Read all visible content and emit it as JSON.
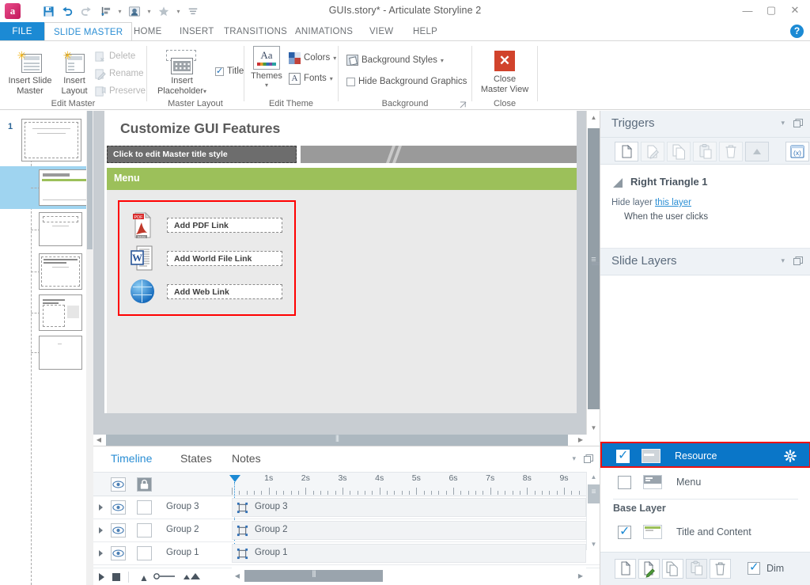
{
  "window": {
    "title": "GUIs.story* -  Articulate Storyline 2",
    "logo_letter": "a",
    "minimize": "—",
    "maximize": "▢",
    "close": "✕",
    "help": "?"
  },
  "quick_access": [
    {
      "name": "save-icon",
      "glyph": "save"
    },
    {
      "name": "undo-icon",
      "glyph": "undo"
    },
    {
      "name": "redo-icon",
      "glyph": "redo"
    },
    {
      "name": "align-icon",
      "glyph": "align"
    },
    {
      "name": "player-icon",
      "glyph": "player"
    },
    {
      "name": "star-icon",
      "glyph": "star"
    },
    {
      "name": "customize-icon",
      "glyph": "bars"
    }
  ],
  "tabs": [
    {
      "label": "FILE",
      "state": "file"
    },
    {
      "label": "SLIDE MASTER",
      "state": "active"
    },
    {
      "label": "HOME",
      "state": "normal"
    },
    {
      "label": "INSERT",
      "state": "normal"
    },
    {
      "label": "TRANSITIONS",
      "state": "normal"
    },
    {
      "label": "ANIMATIONS",
      "state": "normal"
    },
    {
      "label": "VIEW",
      "state": "normal"
    },
    {
      "label": "HELP",
      "state": "normal"
    }
  ],
  "ribbon": {
    "groups": [
      {
        "label": "Edit Master"
      },
      {
        "label": "Master Layout"
      },
      {
        "label": "Edit Theme"
      },
      {
        "label": "Background"
      },
      {
        "label": "Close"
      }
    ],
    "insert_slide_master": {
      "line1": "Insert Slide",
      "line2": "Master"
    },
    "insert_layout": {
      "line1": "Insert",
      "line2": "Layout"
    },
    "delete": "Delete",
    "rename": "Rename",
    "preserve": "Preserve",
    "insert_placeholder": "Insert\nPlaceholder",
    "insert_placeholder_l1": "Insert",
    "insert_placeholder_l2": "Placeholder",
    "title_checkbox": "Title",
    "themes": "Themes",
    "colors": "Colors",
    "fonts": "Fonts",
    "background_styles": "Background Styles",
    "hide_background_graphics": "Hide Background Graphics",
    "close_master_view_l1": "Close",
    "close_master_view_l2": "Master View",
    "dialog_launcher": "⌐"
  },
  "thumbnails": {
    "number": "1",
    "items": [
      {
        "type": "master",
        "selected": false
      },
      {
        "type": "title-content",
        "selected": true
      },
      {
        "type": "title-only",
        "selected": false
      },
      {
        "type": "content-a",
        "selected": false
      },
      {
        "type": "content-b",
        "selected": false
      },
      {
        "type": "blank",
        "selected": false
      }
    ]
  },
  "slide": {
    "title": "Customize GUI Features",
    "master_title_placeholder": "Click to edit Master title style",
    "menu_bar_label": "Menu",
    "links": [
      {
        "icon": "pdf-icon",
        "label": "Add PDF Link"
      },
      {
        "icon": "word-icon",
        "label": "Add World File Link"
      },
      {
        "icon": "web-icon",
        "label": "Add Web Link"
      }
    ]
  },
  "bottom_panel": {
    "tabs": [
      {
        "label": "Timeline",
        "active": true
      },
      {
        "label": "States",
        "active": false
      },
      {
        "label": "Notes",
        "active": false
      }
    ],
    "ruler_labels": [
      "1s",
      "2s",
      "3s",
      "4s",
      "5s",
      "6s",
      "7s",
      "8s",
      "9s"
    ],
    "rows": [
      {
        "name": "Group 3",
        "bar_label": "Group  3"
      },
      {
        "name": "Group 2",
        "bar_label": "Group  2"
      },
      {
        "name": "Group 1",
        "bar_label": "Group  1"
      }
    ],
    "header_icons": [
      {
        "name": "eye-icon"
      },
      {
        "name": "lock-icon"
      }
    ]
  },
  "triggers_panel": {
    "title": "Triggers",
    "buttons": [
      {
        "name": "new-trigger-button",
        "glyph": "page",
        "enabled": true
      },
      {
        "name": "edit-trigger-button",
        "glyph": "edit",
        "enabled": false
      },
      {
        "name": "copy-trigger-button",
        "glyph": "copy",
        "enabled": false
      },
      {
        "name": "paste-trigger-button",
        "glyph": "paste",
        "enabled": false
      },
      {
        "name": "delete-trigger-button",
        "glyph": "trash",
        "enabled": false
      },
      {
        "name": "move-up-trigger-button",
        "glyph": "up",
        "enabled": false
      },
      {
        "name": "manage-variables-button",
        "glyph": "variable",
        "enabled": true
      }
    ],
    "variable_label": "(x)",
    "trigger": {
      "object": "Right Triangle 1",
      "action_prefix": "Hide layer",
      "action_link": "this layer",
      "condition": "When the user clicks"
    }
  },
  "slide_layers_panel": {
    "title": "Slide Layers",
    "layers": [
      {
        "name": "Resource",
        "checked": true,
        "selected": true
      },
      {
        "name": "Menu",
        "checked": false,
        "selected": false
      }
    ],
    "base_layer_label": "Base Layer",
    "base_layer": {
      "name": "Title and Content",
      "checked": true
    },
    "footer_buttons": [
      {
        "name": "new-layer-button",
        "glyph": "page"
      },
      {
        "name": "edit-layer-button",
        "glyph": "editgreen"
      },
      {
        "name": "copy-layer-button",
        "glyph": "copy"
      },
      {
        "name": "paste-layer-button",
        "glyph": "paste"
      },
      {
        "name": "delete-layer-button",
        "glyph": "trash"
      }
    ],
    "dim_label": "Dim",
    "dim_checked": true,
    "gear_icon": "✿"
  },
  "colors": {
    "accent": "#1c8ad4",
    "file_tab": "#1c8ad4",
    "selection_blue": "#0a76c8",
    "selection_red": "#ee1111",
    "menu_green": "#9cc05a",
    "close_red": "#d1432c"
  }
}
